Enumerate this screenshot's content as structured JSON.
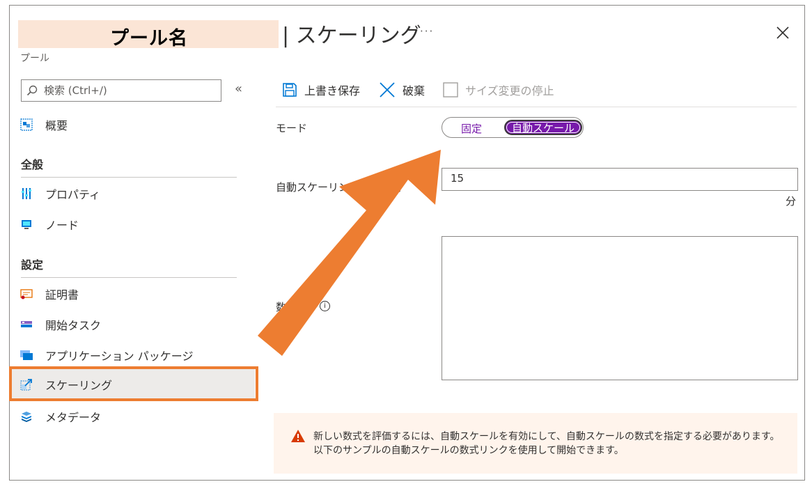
{
  "header": {
    "pool_name_overlay": "プール名",
    "page_title": "| スケーリング",
    "more_label": "···",
    "subtitle": "プール"
  },
  "search": {
    "placeholder": "検索 (Ctrl+/)",
    "collapse_label": "«"
  },
  "sidebar": {
    "overview": "概要",
    "sections": [
      {
        "title": "全般",
        "items": [
          "プロパティ",
          "ノード"
        ]
      },
      {
        "title": "設定",
        "items": [
          "証明書",
          "開始タスク",
          "アプリケーション パッケージ",
          "スケーリング",
          "メタデータ"
        ]
      }
    ],
    "selected": "スケーリング"
  },
  "toolbar": {
    "save": "上書き保存",
    "discard": "破棄",
    "stop_resize": "サイズ変更の停止"
  },
  "form": {
    "mode_label": "モード",
    "mode_options": [
      "固定",
      "自動スケール"
    ],
    "mode_selected": "自動スケール",
    "interval_label": "自動スケーリング検証の間",
    "interval_value": "15",
    "interval_unit": "分",
    "formula_label": "数",
    "formula_value": ""
  },
  "warning": {
    "line1": "新しい数式を評価するには、自動スケールを有効にして、自動スケールの数式を指定する必要があります。",
    "line2": "以下のサンプルの自動スケールの数式リンクを使用して開始できます。"
  },
  "colors": {
    "accent_purple": "#7719aa",
    "highlight_orange": "#ed7d31",
    "warning_bg": "#fff4ec",
    "selected_bg": "#edebe9"
  }
}
